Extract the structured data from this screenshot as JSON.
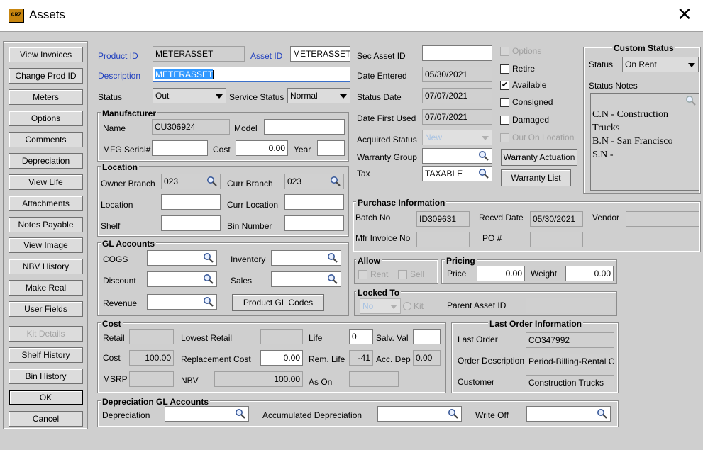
{
  "window": {
    "title": "Assets",
    "icon_text": "CRZ",
    "close_glyph": "✕"
  },
  "sidebar": [
    {
      "label": "View Invoices"
    },
    {
      "label": "Change Prod ID"
    },
    {
      "label": "Meters"
    },
    {
      "label": "Options"
    },
    {
      "label": "Comments"
    },
    {
      "label": "Depreciation"
    },
    {
      "label": "View Life"
    },
    {
      "label": "Attachments"
    },
    {
      "label": "Notes Payable"
    },
    {
      "label": "View Image"
    },
    {
      "label": "NBV History"
    },
    {
      "label": "Make Real"
    },
    {
      "label": "User Fields"
    },
    {
      "label": "Kit Details",
      "disabled": true
    },
    {
      "label": "Shelf History"
    },
    {
      "label": "Bin History"
    },
    {
      "label": "OK"
    },
    {
      "label": "Cancel"
    }
  ],
  "product": {
    "product_id_label": "Product ID",
    "product_id": "METERASSET",
    "asset_id_label": "Asset ID",
    "asset_id": "METERASSET-",
    "description_label": "Description",
    "description": "METERASSET",
    "status_label": "Status",
    "status": "Out",
    "service_status_label": "Service Status",
    "service_status": "Normal"
  },
  "manufacturer": {
    "title": "Manufacturer",
    "name_label": "Name",
    "name": "CU306924",
    "model_label": "Model",
    "model": "",
    "serial_label": "MFG Serial#",
    "serial": "",
    "cost_label": "Cost",
    "cost": "0.00",
    "year_label": "Year",
    "year": ""
  },
  "location": {
    "title": "Location",
    "owner_branch_label": "Owner Branch",
    "owner_branch": "023",
    "curr_branch_label": "Curr Branch",
    "curr_branch": "023",
    "location_label": "Location",
    "location": "",
    "curr_location_label": "Curr Location",
    "curr_location": "",
    "shelf_label": "Shelf",
    "shelf": "",
    "bin_label": "Bin Number",
    "bin": ""
  },
  "gl": {
    "title": "GL Accounts",
    "cogs_label": "COGS",
    "inventory_label": "Inventory",
    "discount_label": "Discount",
    "sales_label": "Sales",
    "revenue_label": "Revenue",
    "product_gl_button": "Product GL Codes"
  },
  "cost": {
    "title": "Cost",
    "retail_label": "Retail",
    "retail": "",
    "lowest_retail_label": "Lowest Retail",
    "lowest_retail": "",
    "life_label": "Life",
    "life": "0",
    "salv_label": "Salv. Val",
    "salv": "",
    "cost_label": "Cost",
    "cost": "100.00",
    "replacement_label": "Replacement Cost",
    "replacement": "0.00",
    "rem_life_label": "Rem. Life",
    "rem_life": "-41",
    "acc_dep_label": "Acc. Dep",
    "acc_dep": "0.00",
    "msrp_label": "MSRP",
    "msrp": "",
    "nbv_label": "NBV",
    "nbv": "100.00",
    "as_on_label": "As On",
    "as_on": ""
  },
  "dep_gl": {
    "title": "Depreciation GL Accounts",
    "depreciation_label": "Depreciation",
    "accumulated_label": "Accumulated Depreciation",
    "write_off_label": "Write Off"
  },
  "dates": {
    "sec_asset_label": "Sec Asset ID",
    "sec_asset": "",
    "entered_label": "Date Entered",
    "entered": "05/30/2021",
    "status_date_label": "Status Date",
    "status_date": "07/07/2021",
    "first_used_label": "Date First Used",
    "first_used": "07/07/2021",
    "acquired_label": "Acquired Status",
    "acquired": "New",
    "warranty_group_label": "Warranty Group",
    "warranty_group": "",
    "tax_label": "Tax",
    "tax": "TAXABLE"
  },
  "flags": [
    {
      "label": "Options",
      "checked": false,
      "disabled": true
    },
    {
      "label": "Retire",
      "checked": false,
      "disabled": false
    },
    {
      "label": "Available",
      "checked": true,
      "disabled": false
    },
    {
      "label": "Consigned",
      "checked": false,
      "disabled": false
    },
    {
      "label": "Damaged",
      "checked": false,
      "disabled": false
    },
    {
      "label": "Out On Location",
      "checked": false,
      "disabled": true
    }
  ],
  "warranty": {
    "actuation_button": "Warranty Actuation",
    "list_button": "Warranty List"
  },
  "custom_status": {
    "title": "Custom Status",
    "status_label": "Status",
    "status": "On Rent",
    "notes_label": "Status Notes",
    "notes": "C.N - Construction\nTrucks\nB.N - San Francisco\nS.N -"
  },
  "purchase": {
    "title": "Purchase Information",
    "batch_label": "Batch No",
    "batch": "ID309631",
    "recvd_label": "Recvd Date",
    "recvd": "05/30/2021",
    "vendor_label": "Vendor",
    "vendor": "",
    "mfr_invoice_label": "Mfr Invoice No",
    "mfr_invoice": "",
    "po_label": "PO #",
    "po": ""
  },
  "allow": {
    "title": "Allow",
    "rent_label": "Rent",
    "sell_label": "Sell"
  },
  "pricing": {
    "title": "Pricing",
    "price_label": "Price",
    "price": "0.00",
    "weight_label": "Weight",
    "weight": "0.00"
  },
  "locked": {
    "title": "Locked To",
    "value": "No",
    "kit_label": "Kit",
    "parent_label": "Parent Asset ID",
    "parent": ""
  },
  "last_order": {
    "title": "Last Order Information",
    "order_label": "Last Order",
    "order": "CO347992",
    "desc_label": "Order Description",
    "desc": "Period-Billing-Rental C",
    "customer_label": "Customer",
    "customer": "Construction Trucks"
  }
}
